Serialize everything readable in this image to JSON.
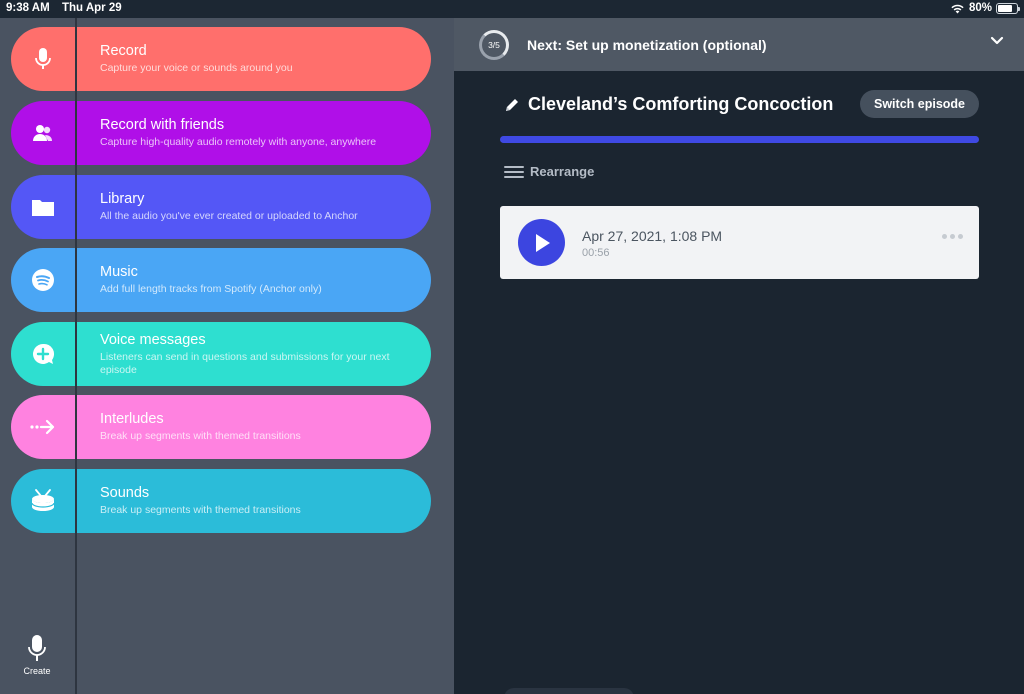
{
  "status": {
    "time": "9:38 AM",
    "date": "Thu Apr 29",
    "battery": "80%",
    "battery_level": 0.8
  },
  "menu": {
    "items": [
      {
        "title": "Record",
        "subtitle": "Capture your voice or sounds around you",
        "color": "#ff6f6c",
        "icon": "microphone-icon"
      },
      {
        "title": "Record with friends",
        "subtitle": "Capture high-quality audio remotely with anyone, anywhere",
        "color": "#b00fe8",
        "icon": "friends-icon"
      },
      {
        "title": "Library",
        "subtitle": "All the audio you've ever created or uploaded to Anchor",
        "color": "#5457f6",
        "icon": "folder-icon"
      },
      {
        "title": "Music",
        "subtitle": "Add full length tracks from Spotify (Anchor only)",
        "color": "#4aa6f5",
        "icon": "spotify-icon"
      },
      {
        "title": "Voice messages",
        "subtitle": "Listeners can send in questions and submissions for your next episode",
        "color": "#2edfd0",
        "icon": "voice-message-icon"
      },
      {
        "title": "Interludes",
        "subtitle": "Break up segments with themed transitions",
        "color": "#ff82e0",
        "icon": "arrow-right-icon"
      },
      {
        "title": "Sounds",
        "subtitle": "Break up segments with themed transitions",
        "color": "#2bbcd9",
        "icon": "drum-icon"
      }
    ]
  },
  "create": {
    "label": "Create"
  },
  "next_step": {
    "progress": "3/5",
    "progress_fraction": 0.6,
    "label": "Next: Set up monetization (optional)"
  },
  "episode": {
    "title": "Cleveland’s Comforting Concoction",
    "switch_label": "Switch episode",
    "progress_fraction": 1.0,
    "rearrange_label": "Rearrange",
    "segments": [
      {
        "date": "Apr 27, 2021, 1:08 PM",
        "duration": "00:56"
      }
    ]
  },
  "colors": {
    "accent": "#3c45e0",
    "panel_dark": "#1b2530",
    "panel_left": "#4a5361"
  }
}
